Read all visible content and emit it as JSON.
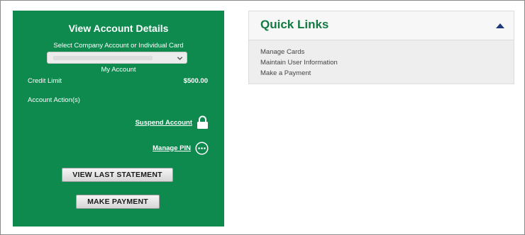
{
  "account_panel": {
    "title": "View Account Details",
    "select_label": "Select Company Account or Individual Card",
    "selected_account": "My Account",
    "credit_limit_label": "Credit Limit",
    "credit_limit_value": "$500.00",
    "actions_label": "Account Action(s)",
    "suspend_label": "Suspend Account",
    "manage_pin_label": "Manage PIN",
    "view_statement_label": "VIEW LAST STATEMENT",
    "make_payment_label": "MAKE PAYMENT"
  },
  "quick_links": {
    "title": "Quick Links",
    "items": [
      {
        "label": "Manage Cards"
      },
      {
        "label": "Maintain User Information"
      },
      {
        "label": "Make a Payment"
      }
    ]
  },
  "icons": {
    "suspend": "lock-icon",
    "pin": "more-dots-icon",
    "collapse": "caret-up-icon",
    "select": "chevron-down-icon"
  },
  "colors": {
    "panel_green": "#0f8a4f",
    "quick_links_title": "#137a43",
    "collapse_arrow": "#1e3a7a"
  }
}
